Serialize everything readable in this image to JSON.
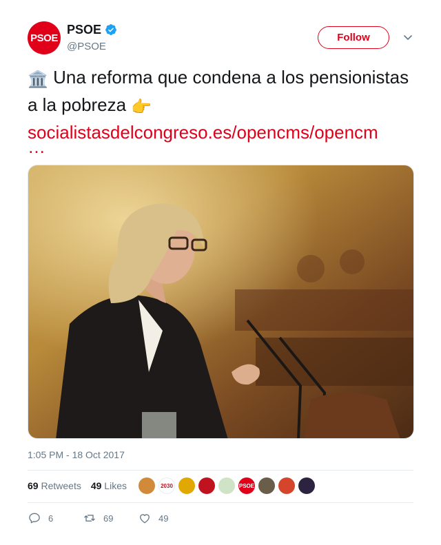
{
  "account": {
    "avatar_text": "PSOE",
    "display_name": "PSOE",
    "handle": "@PSOE",
    "verified_icon": "verified-badge-icon"
  },
  "header": {
    "follow_label": "Follow",
    "menu_icon": "chevron-down-icon"
  },
  "tweet": {
    "emoji_start": "🏛️",
    "text": "Una reforma que condena a los pensionistas a la pobreza",
    "emoji_end": "👉",
    "link_text": "socialistasdelcongreso.es/opencms/opencm",
    "link_ellipsis": "…",
    "photo_alt": "woman-speaking-at-podium"
  },
  "timestamp": "1:05 PM - 18 Oct 2017",
  "stats": {
    "retweets_count": "69",
    "retweets_label": "Retweets",
    "likes_count": "49",
    "likes_label": "Likes",
    "liker_avatars": [
      {
        "name": "liker-avatar-sunset",
        "color": "#d08a3a",
        "text": ""
      },
      {
        "name": "liker-avatar-agenda2030",
        "color": "#ffffff",
        "text": "2030"
      },
      {
        "name": "liker-avatar-cartoon",
        "color": "#e0a800",
        "text": ""
      },
      {
        "name": "liker-avatar-red-logo",
        "color": "#c1121f",
        "text": ""
      },
      {
        "name": "liker-avatar-drawing",
        "color": "#cfe3c7",
        "text": ""
      },
      {
        "name": "liker-avatar-psoe",
        "color": "#e0001a",
        "text": "PSOE"
      },
      {
        "name": "liker-avatar-woman",
        "color": "#6a5d4a",
        "text": ""
      },
      {
        "name": "liker-avatar-flag",
        "color": "#d4452b",
        "text": ""
      },
      {
        "name": "liker-avatar-dark",
        "color": "#2b2340",
        "text": ""
      }
    ]
  },
  "actions": {
    "reply_count": "6",
    "retweet_count": "69",
    "like_count": "49"
  },
  "colors": {
    "brand": "#e0001a",
    "muted": "#657786",
    "text": "#14171a"
  }
}
